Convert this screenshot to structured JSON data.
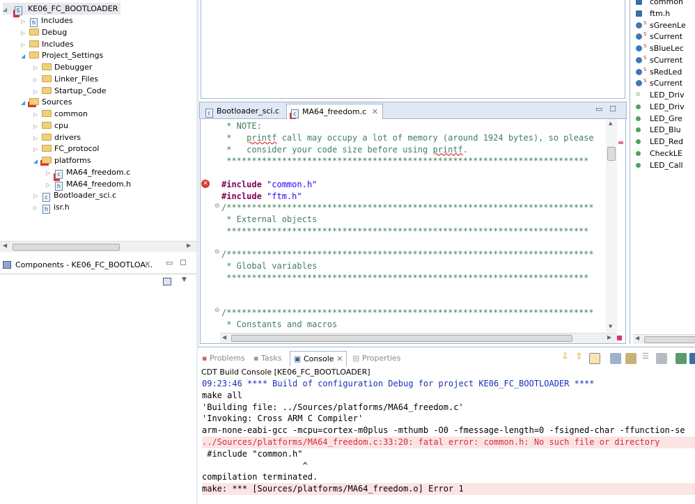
{
  "project_tree": {
    "root": "KE06_FC_BOOTLOADER",
    "items": [
      {
        "label": "Includes",
        "depth": 1,
        "icon": "includes-icon"
      },
      {
        "label": "Debug",
        "depth": 1,
        "icon": "folder-icon"
      },
      {
        "label": "Includes",
        "depth": 1,
        "icon": "folder-icon"
      },
      {
        "label": "Project_Settings",
        "depth": 1,
        "icon": "folder-icon",
        "expanded": true
      },
      {
        "label": "Debugger",
        "depth": 2,
        "icon": "folder-icon"
      },
      {
        "label": "Linker_Files",
        "depth": 2,
        "icon": "folder-icon"
      },
      {
        "label": "Startup_Code",
        "depth": 2,
        "icon": "folder-icon"
      },
      {
        "label": "Sources",
        "depth": 1,
        "icon": "folder-icon",
        "expanded": true,
        "error": true
      },
      {
        "label": "common",
        "depth": 2,
        "icon": "folder-icon"
      },
      {
        "label": "cpu",
        "depth": 2,
        "icon": "folder-icon"
      },
      {
        "label": "drivers",
        "depth": 2,
        "icon": "folder-icon"
      },
      {
        "label": "FC_protocol",
        "depth": 2,
        "icon": "folder-icon"
      },
      {
        "label": "platforms",
        "depth": 2,
        "icon": "folder-icon",
        "expanded": true,
        "error": true
      },
      {
        "label": "MA64_freedom.c",
        "depth": 3,
        "icon": "c-file-icon",
        "error": true
      },
      {
        "label": "MA64_freedom.h",
        "depth": 3,
        "icon": "h-file-icon"
      },
      {
        "label": "Bootloader_sci.c",
        "depth": 2,
        "icon": "c-file-icon"
      },
      {
        "label": "isr.h",
        "depth": 2,
        "icon": "h-file-icon"
      }
    ]
  },
  "components_panel": {
    "title": "Components - KE06_FC_BOOTLOA..."
  },
  "editor": {
    "tabs": [
      {
        "label": "Bootloader_sci.c",
        "active": false
      },
      {
        "label": "MA64_freedom.c",
        "active": true,
        "error": true
      }
    ],
    "lines": [
      " * NOTE:",
      " *   printf call may occupy a lot of memory (around 1924 bytes), so please",
      " *   consider your code size before using printf.",
      " ************************************************************************",
      "",
      "#include \"common.h\"",
      "#include \"ftm.h\"",
      "/*************************************************************************",
      " * External objects",
      " ************************************************************************",
      "",
      "/*************************************************************************",
      " * Global variables",
      " ************************************************************************",
      "",
      "",
      "/*************************************************************************",
      " * Constants and macros"
    ]
  },
  "outline": {
    "items": [
      "common",
      "ftm.h",
      "sGreenLe",
      "sCurrent",
      "sBlueLec",
      "sCurrent",
      "sRedLed",
      "sCurrent",
      "LED_Driv",
      "LED_Driv",
      "LED_Gre",
      "LED_Blu",
      "LED_Red",
      "CheckLE",
      "LED_Call"
    ]
  },
  "console": {
    "tabs": [
      "Problems",
      "Tasks",
      "Console",
      "Properties"
    ],
    "title": "CDT Build Console [KE06_FC_BOOTLOADER]",
    "lines": [
      {
        "text": "09:23:46 **** Build of configuration Debug for project KE06_FC_BOOTLOADER ****",
        "type": "info"
      },
      {
        "text": "make all",
        "type": "normal"
      },
      {
        "text": "'Building file: ../Sources/platforms/MA64_freedom.c'",
        "type": "normal"
      },
      {
        "text": "'Invoking: Cross ARM C Compiler'",
        "type": "normal"
      },
      {
        "text": "arm-none-eabi-gcc -mcpu=cortex-m0plus -mthumb -O0 -fmessage-length=0 -fsigned-char -ffunction-se",
        "type": "normal"
      },
      {
        "text": "../Sources/platforms/MA64_freedom.c:33:20: fatal error: common.h: No such file or directory",
        "type": "error"
      },
      {
        "text": " #include \"common.h\"",
        "type": "normal"
      },
      {
        "text": "                    ^",
        "type": "normal"
      },
      {
        "text": "compilation terminated.",
        "type": "normal"
      },
      {
        "text": "make: *** [Sources/platforms/MA64_freedom.o] Error 1",
        "type": "errorline"
      }
    ]
  },
  "colors": {
    "comment": "#3f7f5f",
    "keyword": "#7f0055",
    "string": "#2a00ff",
    "console_info": "#1a2fb8",
    "error_bg": "#fde4e4"
  }
}
